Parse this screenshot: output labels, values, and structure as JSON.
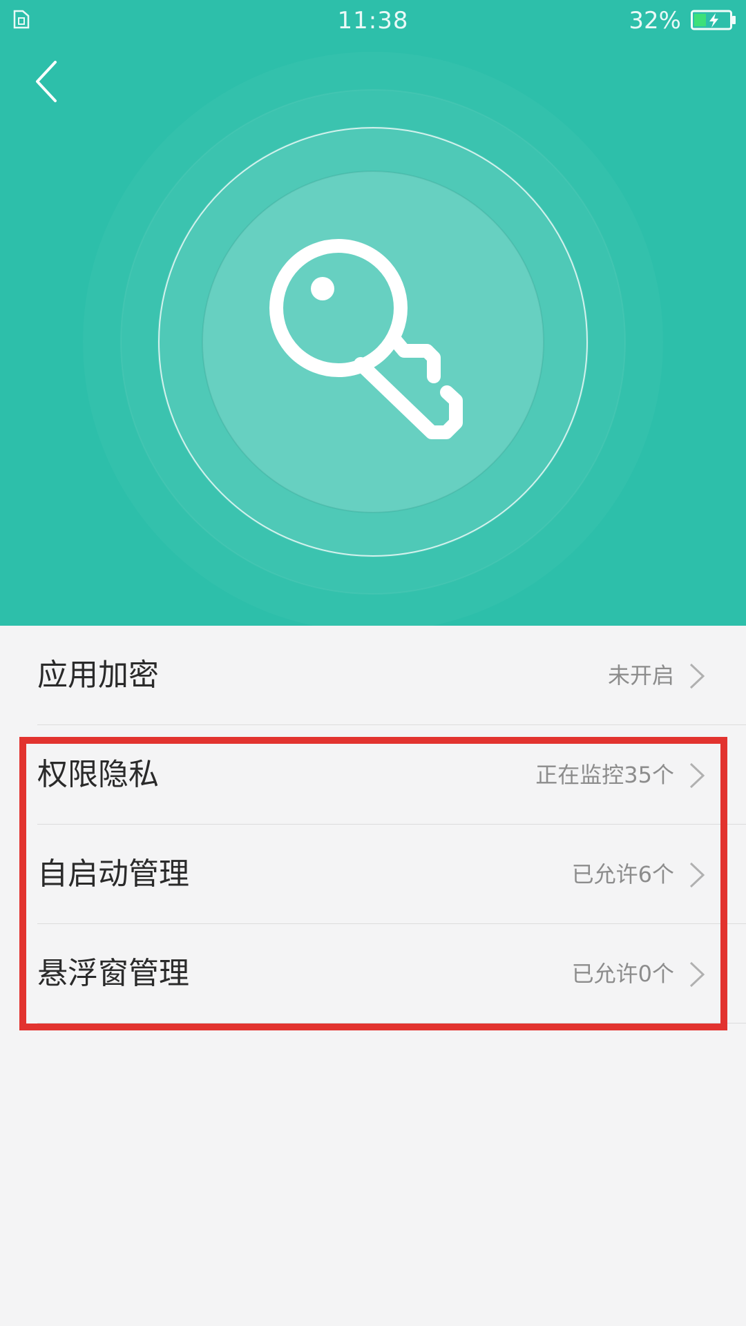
{
  "status_bar": {
    "time": "11:38",
    "battery_percent": "32%",
    "sim_icon": "sim-card-icon",
    "battery_icon": "battery-charging-icon",
    "battery_level": 0.32
  },
  "header": {
    "back_icon": "chevron-left-icon",
    "hero_icon": "key-icon",
    "background_color": "#2dbfaa"
  },
  "list": {
    "items": [
      {
        "title": "应用加密",
        "status": "未开启"
      },
      {
        "title": "权限隐私",
        "status": "正在监控35个"
      },
      {
        "title": "自启动管理",
        "status": "已允许6个"
      },
      {
        "title": "悬浮窗管理",
        "status": "已允许0个"
      }
    ]
  },
  "annotation": {
    "color": "#e2332f"
  }
}
